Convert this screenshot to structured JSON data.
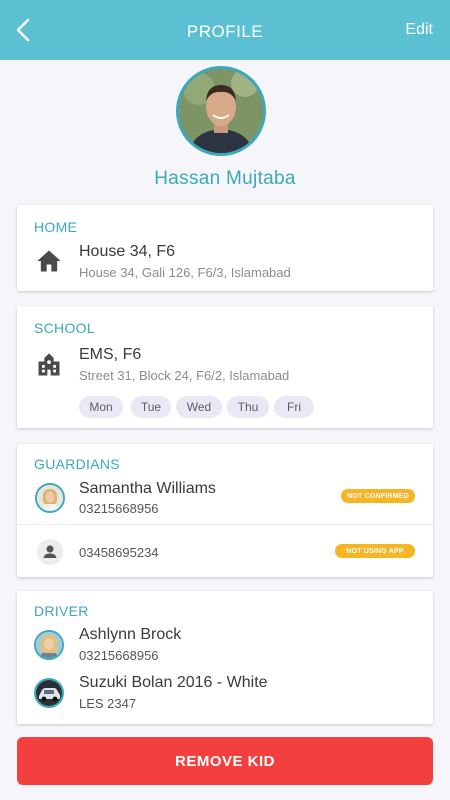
{
  "header": {
    "title": "PROFILE",
    "edit_label": "Edit"
  },
  "profile": {
    "name": "Hassan Mujtaba"
  },
  "home": {
    "section_title": "HOME",
    "name": "House 34, F6",
    "address": "House 34, Gali 126, F6/3, Islamabad",
    "icon": "home-icon"
  },
  "school": {
    "section_title": "SCHOOL",
    "name": "EMS, F6",
    "address": "Street 31, Block 24, F6/2, Islamabad",
    "icon": "school-icon",
    "days": [
      "Mon",
      "Tue",
      "Wed",
      "Thu",
      "Fri"
    ]
  },
  "guardians": {
    "section_title": "GUARDIANS",
    "items": [
      {
        "name": "Samantha Williams",
        "phone": "03215668956",
        "status": "NOT CONFIRMED"
      },
      {
        "phone": "03458695234",
        "status": "NOT USING APP"
      }
    ]
  },
  "driver": {
    "section_title": "DRIVER",
    "name": "Ashlynn Brock",
    "phone": "03215668956",
    "vehicle": "Suzuki Bolan 2016 - White",
    "plate": "LES 2347"
  },
  "actions": {
    "remove_label": "REMOVE KID"
  },
  "colors": {
    "accent": "#5bc0d2",
    "accent_text": "#3aa9bc",
    "danger": "#f3403f",
    "badge": "#f6b524"
  }
}
